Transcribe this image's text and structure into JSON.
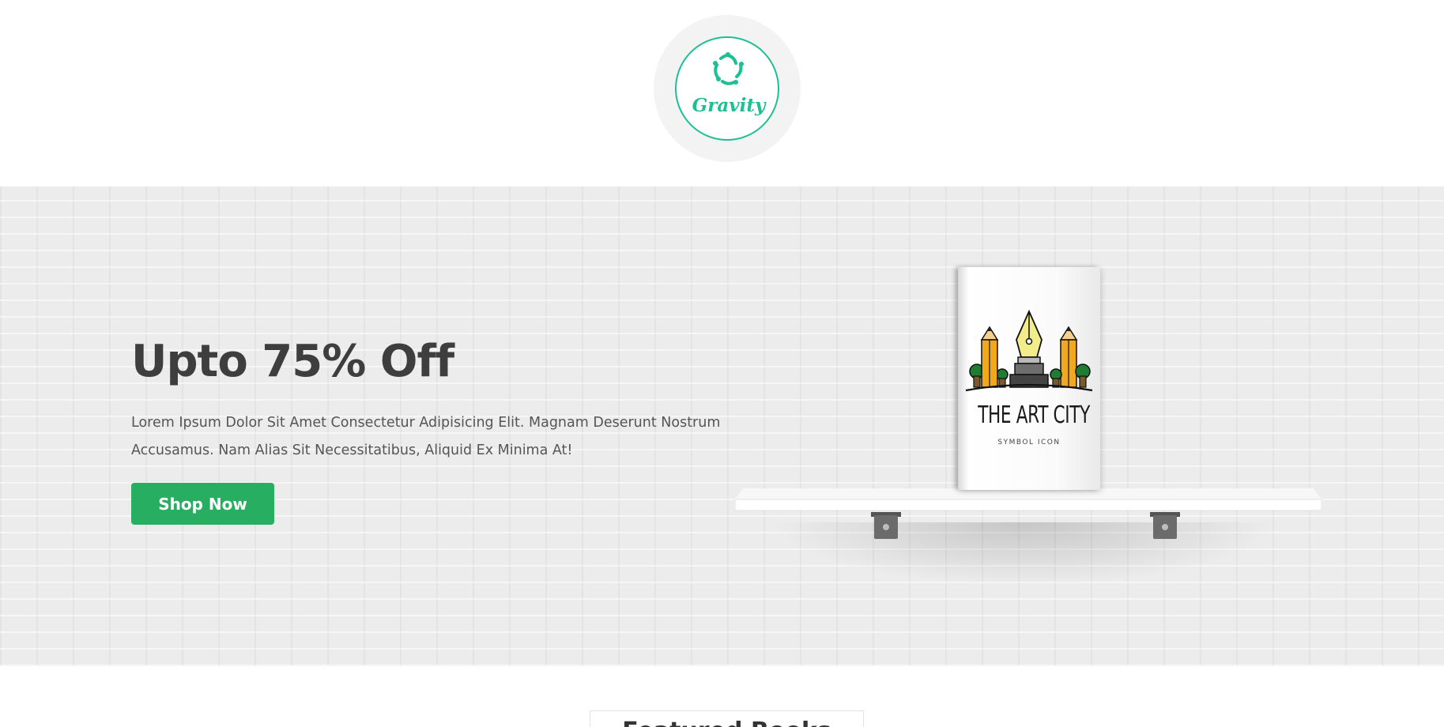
{
  "brand": {
    "name": "Gravity",
    "accent_color": "#1fbf94",
    "logo_icon": "gravity-swirl-icon"
  },
  "hero": {
    "title": "Upto 75% Off",
    "description": "Lorem Ipsum Dolor Sit Amet Consectetur Adipisicing Elit. Magnam Deserunt Nostrum Accusamus. Nam Alias Sit Necessitatibus, Aliquid Ex Minima At!",
    "cta_label": "Shop Now",
    "cta_color": "#27ae60"
  },
  "book": {
    "title": "THE ART CITY",
    "subtitle": "SYMBOL ICON"
  },
  "featured": {
    "title": "Featured Books"
  }
}
